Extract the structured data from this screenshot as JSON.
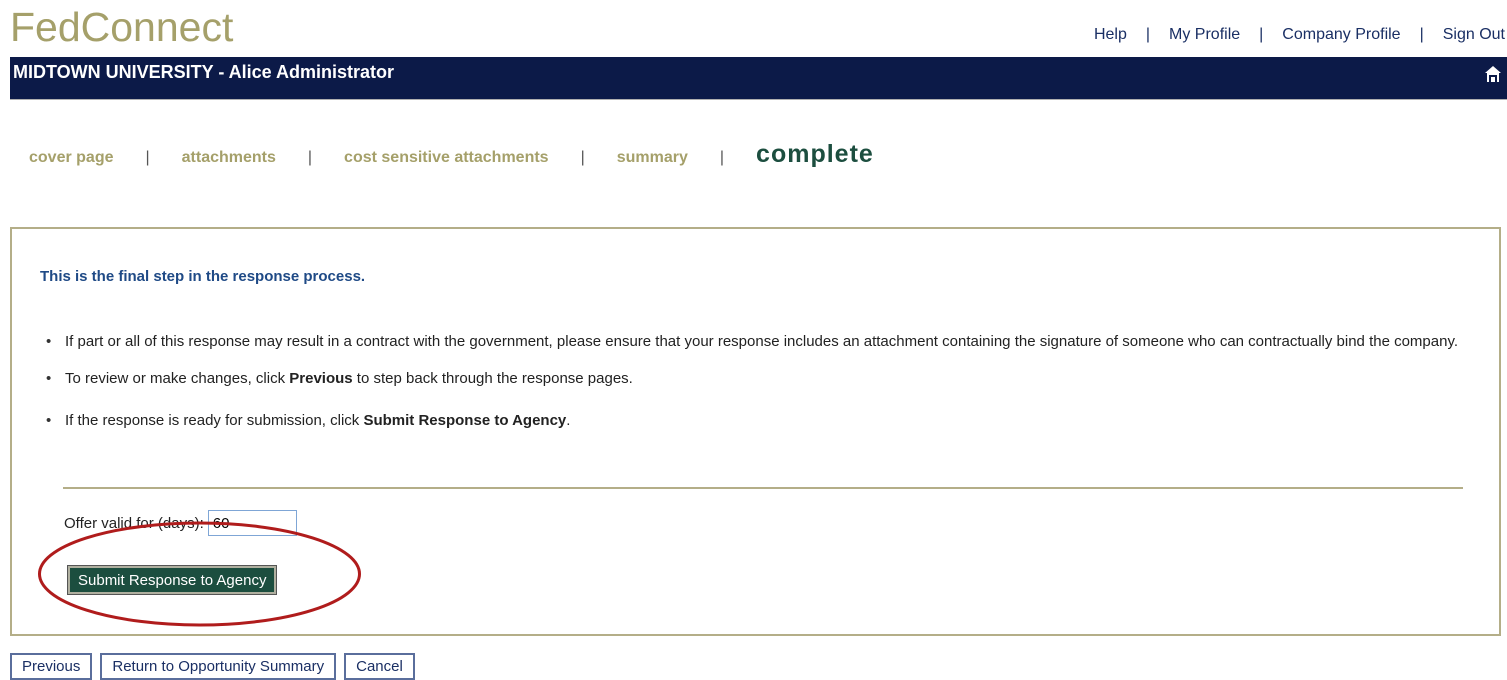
{
  "header": {
    "logo_text": "FedConnect",
    "links": [
      "Help",
      "My Profile",
      "Company Profile",
      "Sign Out"
    ],
    "separator": "|"
  },
  "navbar": {
    "org_user": "MIDTOWN UNIVERSITY - Alice Administrator",
    "home_icon": "home-icon"
  },
  "steps": {
    "items": [
      "cover page",
      "attachments",
      "cost sensitive attachments",
      "summary"
    ],
    "current": "complete",
    "separator": "|"
  },
  "panel": {
    "heading": "This is the final step in the response process.",
    "bullet1": "If part or all of this response may result in a contract with the government, please ensure that your response includes an attachment containing the signature of someone who can contractually bind the company.",
    "bullet2_pre": "To review or make changes, click ",
    "bullet2_bold": "Previous",
    "bullet2_post": " to step back through the response pages.",
    "bullet3_pre": "If the response is ready for submission, click ",
    "bullet3_bold": "Submit Response to Agency",
    "bullet3_post": ".",
    "offer_label": "Offer valid for (days):",
    "offer_value": "60",
    "submit_label": "Submit Response to Agency"
  },
  "bottom": {
    "previous_label": "Previous",
    "return_label": "Return to Opportunity Summary",
    "cancel_label": "Cancel"
  },
  "colors": {
    "brand_olive": "#a5a06a",
    "navbar_navy": "#0c1a48",
    "current_step_green": "#1c4e3f",
    "highlight_red": "#b01c1c"
  }
}
